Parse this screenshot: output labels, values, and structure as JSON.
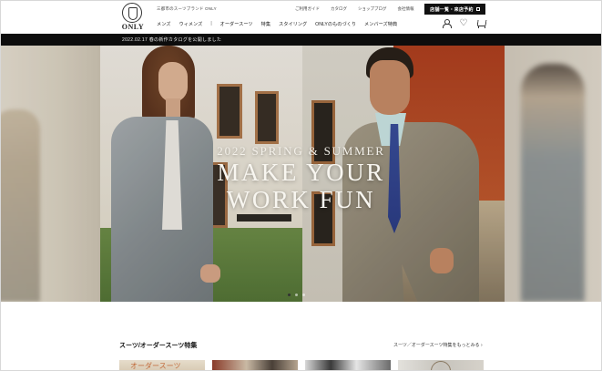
{
  "brand": {
    "tagline": "三都市のスーツブランド ONLY",
    "logo_text": "ONLY"
  },
  "utility_links": [
    "ご利用ガイド",
    "カタログ",
    "ショップブログ",
    "会社情報"
  ],
  "store_button": {
    "label": "店舗一覧・来店予約"
  },
  "nav": {
    "items": [
      "メンズ",
      "ウィメンズ",
      "|",
      "オーダースーツ",
      "特集",
      "スタイリング",
      "ONLYのものづくり",
      "メンバーズ特典"
    ]
  },
  "icons": {
    "user": "user-icon",
    "favorite": "heart-icon",
    "cart": "cart-icon"
  },
  "news": {
    "text": "2022.02.17 春の新作カタログを公開しました"
  },
  "hero": {
    "subtitle": "2022 SPRING & SUMMER",
    "title_line1": "MAKE YOUR",
    "title_line2": "WORK FUN",
    "slide_count": 3,
    "active_slide": 1
  },
  "section": {
    "title": "スーツ/オーダースーツ特集",
    "more_link": "スーツ／オーダースーツ特集をもっとみる ›",
    "thumb1_text": "オーダースーツ"
  },
  "colors": {
    "header_bg": "#ffffff",
    "newsbar_bg": "#0d0d0d",
    "button_bg": "#111111",
    "text": "#222222"
  }
}
